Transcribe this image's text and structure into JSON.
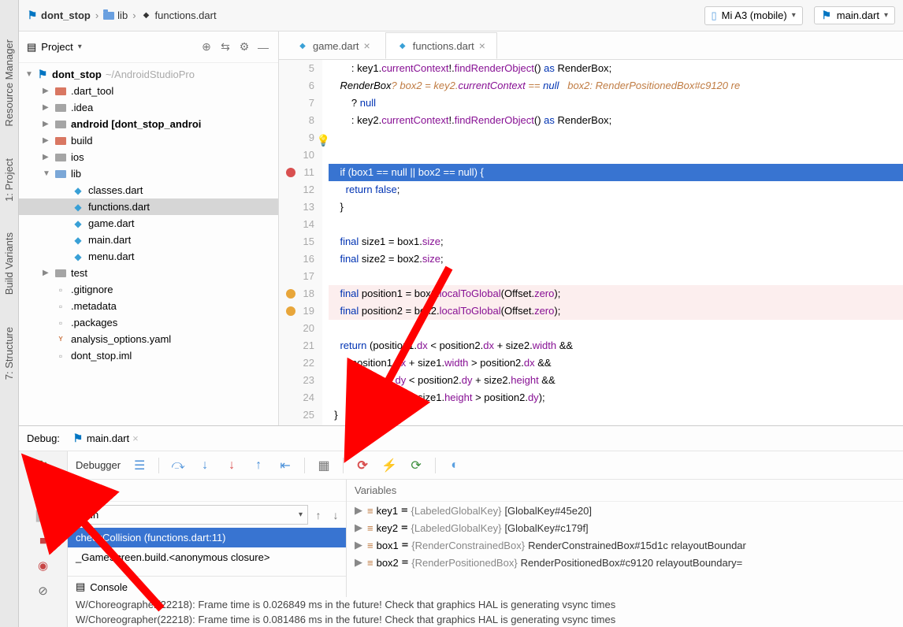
{
  "breadcrumb": {
    "root": "dont_stop",
    "folder": "lib",
    "file": "functions.dart"
  },
  "device": {
    "name": "Mi A3 (mobile)"
  },
  "runconfig": {
    "name": "main.dart"
  },
  "projectView": {
    "title": "Project",
    "root": {
      "name": "dont_stop",
      "path": "~/AndroidStudioPro"
    },
    "items": [
      {
        "name": ".dart_tool",
        "icon": "folder-r",
        "indent": 1,
        "arrow": "▶"
      },
      {
        "name": ".idea",
        "icon": "folder-g",
        "indent": 1,
        "arrow": "▶"
      },
      {
        "name": "android",
        "suffix": "[dont_stop_androi",
        "icon": "folder-g",
        "indent": 1,
        "arrow": "▶",
        "bold": true
      },
      {
        "name": "build",
        "icon": "folder-r",
        "indent": 1,
        "arrow": "▶"
      },
      {
        "name": "ios",
        "icon": "folder-g",
        "indent": 1,
        "arrow": "▶"
      },
      {
        "name": "lib",
        "icon": "folder-b",
        "indent": 1,
        "arrow": "▼"
      },
      {
        "name": "classes.dart",
        "icon": "dart",
        "indent": 2
      },
      {
        "name": "functions.dart",
        "icon": "dart",
        "indent": 2,
        "selected": true
      },
      {
        "name": "game.dart",
        "icon": "dart",
        "indent": 2
      },
      {
        "name": "main.dart",
        "icon": "dart",
        "indent": 2
      },
      {
        "name": "menu.dart",
        "icon": "dart",
        "indent": 2
      },
      {
        "name": "test",
        "icon": "folder-g",
        "indent": 1,
        "arrow": "▶"
      },
      {
        "name": ".gitignore",
        "icon": "file",
        "indent": 1
      },
      {
        "name": ".metadata",
        "icon": "file",
        "indent": 1
      },
      {
        "name": ".packages",
        "icon": "file",
        "indent": 1
      },
      {
        "name": "analysis_options.yaml",
        "icon": "yaml",
        "indent": 1
      },
      {
        "name": "dont_stop.iml",
        "icon": "file",
        "indent": 1
      }
    ]
  },
  "editorTabs": [
    {
      "name": "game.dart",
      "active": false
    },
    {
      "name": "functions.dart",
      "active": true
    }
  ],
  "code": {
    "startLine": 5,
    "lines": [
      {
        "n": 5,
        "txt": "        : key1.currentContext!.findRenderObject() as RenderBox;"
      },
      {
        "n": 6,
        "txt": "    RenderBox? box2 = key2.currentContext == null   box2: RenderPositionedBox#c9120 re",
        "inlay": true
      },
      {
        "n": 7,
        "txt": "        ? null"
      },
      {
        "n": 8,
        "txt": "        : key2.currentContext!.findRenderObject() as RenderBox;"
      },
      {
        "n": 9,
        "txt": "",
        "bulb": true
      },
      {
        "n": 10,
        "txt": ""
      },
      {
        "n": 11,
        "txt": "    if (box1 == null || box2 == null) {",
        "bp": true,
        "hl": "blue"
      },
      {
        "n": 12,
        "txt": "      return false;"
      },
      {
        "n": 13,
        "txt": "    }"
      },
      {
        "n": 14,
        "txt": ""
      },
      {
        "n": 15,
        "txt": "    final size1 = box1.size;"
      },
      {
        "n": 16,
        "txt": "    final size2 = box2.size;"
      },
      {
        "n": 17,
        "txt": ""
      },
      {
        "n": 18,
        "txt": "    final position1 = box1.localToGlobal(Offset.zero);",
        "warn": true,
        "hl": "pink"
      },
      {
        "n": 19,
        "txt": "    final position2 = box2.localToGlobal(Offset.zero);",
        "warn": true,
        "hl": "pink"
      },
      {
        "n": 20,
        "txt": ""
      },
      {
        "n": 21,
        "txt": "    return (position1.dx < position2.dx + size2.width &&"
      },
      {
        "n": 22,
        "txt": "        position1.dx + size1.width > position2.dx &&"
      },
      {
        "n": 23,
        "txt": "        position1.dy < position2.dy + size2.height &&"
      },
      {
        "n": 24,
        "txt": "        position1.dy + size1.height > position2.dy);"
      },
      {
        "n": 25,
        "txt": "  }"
      }
    ]
  },
  "debug": {
    "label": "Debug:",
    "file": "main.dart",
    "debuggerTab": "Debugger",
    "framesLabel": "Frames",
    "variablesLabel": "Variables",
    "mainThread": "main",
    "frames": [
      {
        "name": "checkCollision (functions.dart:11)",
        "selected": true
      },
      {
        "name": "_GameScreen.build.<anonymous closure>"
      }
    ],
    "vars": [
      {
        "name": "key1",
        "type": "{LabeledGlobalKey}",
        "val": "[GlobalKey#45e20]"
      },
      {
        "name": "key2",
        "type": "{LabeledGlobalKey}",
        "val": "[GlobalKey#c179f]"
      },
      {
        "name": "box1",
        "type": "{RenderConstrainedBox}",
        "val": "RenderConstrainedBox#15d1c relayoutBoundar"
      },
      {
        "name": "box2",
        "type": "{RenderPositionedBox}",
        "val": "RenderPositionedBox#c9120 relayoutBoundary="
      }
    ],
    "consoleLabel": "Console",
    "consoleLines": [
      "W/Choreographer(22218): Frame time is 0.026849 ms in the future!  Check that graphics HAL is generating vsync times",
      "W/Choreographer(22218): Frame time is 0.081486 ms in the future!  Check that graphics HAL is generating vsync times"
    ]
  },
  "sideTabs": {
    "resourceManager": "Resource Manager",
    "project": "1: Project",
    "buildVariants": "Build Variants",
    "structure": "7: Structure"
  }
}
